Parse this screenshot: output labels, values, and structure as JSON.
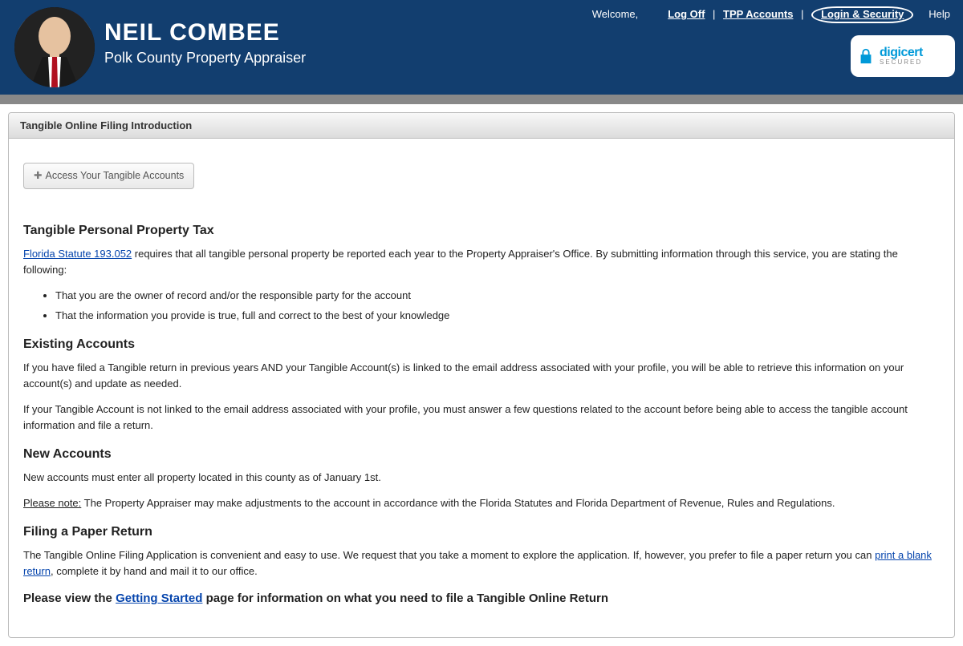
{
  "header": {
    "name": "NEIL COMBEE",
    "subtitle": "Polk County Property Appraiser",
    "welcome": "Welcome,",
    "nav": {
      "logoff": "Log Off",
      "tpp": "TPP Accounts",
      "login_security": "Login & Security",
      "help": "Help"
    },
    "badge": {
      "brand": "digicert",
      "tag": "SECURED"
    }
  },
  "panel": {
    "title": "Tangible Online Filing Introduction",
    "access_btn": "Access Your Tangible Accounts",
    "sec1_title": "Tangible Personal Property Tax",
    "statute_link": "Florida Statute 193.052",
    "sec1_text": " requires that all tangible personal property be reported each year to the Property Appraiser's Office. By submitting information through this service, you are stating the following:",
    "bullets": [
      "That you are the owner of record and/or the responsible party for the account",
      "That the information you provide is true, full and correct to the best of your knowledge"
    ],
    "sec2_title": "Existing Accounts",
    "sec2_p1": "If you have filed a Tangible return in previous years AND your Tangible Account(s) is linked to the email address associated with your profile, you will be able to retrieve this information on your account(s) and update as needed.",
    "sec2_p2": "If your Tangible Account is not linked to the email address associated with your profile, you must answer a few questions related to the account before being able to access the tangible account information and file a return.",
    "sec3_title": "New Accounts",
    "sec3_p1": "New accounts must enter all property located in this county as of January 1st.",
    "please_note": "Please note:",
    "sec3_p2": " The Property Appraiser may make adjustments to the account in accordance with the Florida Statutes and Florida Department of Revenue, Rules and Regulations.",
    "sec4_title": "Filing a Paper Return",
    "sec4_p1a": "The Tangible Online Filing Application is convenient and easy to use. We request that you take a moment to explore the application. If, however, you prefer to file a paper return you can ",
    "print_link": "print a blank return",
    "sec4_p1b": ", complete it by hand and mail it to our office.",
    "final_a": "Please view the ",
    "getting_started": "Getting Started",
    "final_b": " page for information on what you need to file a Tangible Online Return"
  }
}
